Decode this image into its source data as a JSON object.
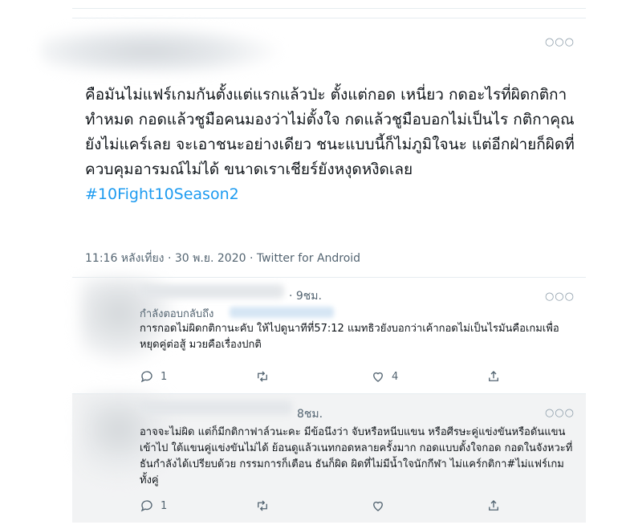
{
  "main_tweet": {
    "more_icon": "more-horizontal-icon",
    "text": "คือมันไม่แฟร์เกมกันตั้งแต่แรกแล้วป่ะ ตั้งแต่กอด เหนี่ยว กดอะไรที่ผิดกติกาทำหมด กอดแล้วชูมือคนมองว่าไม่ตั้งใจ กดแล้วชูมือบอกไม่เป็นไร กติกาคุณยังไม่แคร์เลย จะเอาชนะอย่างเดียว ชนะแบบนี้ก็ไม่ภูมิใจนะ แต่อีกฝ่ายก็ผิดที่ควบคุมอารมณ์ไม่ได้ ขนาดเราเชียร์ยังหงุดหงิดเลย",
    "hashtag": "#10Fight10Season2",
    "meta": "11:16 หลังเที่ยง · 30 พ.ย. 2020 · Twitter for Android"
  },
  "replies": [
    {
      "time": "· 9ชม.",
      "replying_to": "กำลังตอบกลับถึง",
      "text": "การกอดไม่ผิดกติกานะคับ ให้ไปดูนาทีที่57:12 แมทธิวยังบอกว่าเค้ากอดไม่เป็นไรมันคือเกมเพื่อหยุดคู่ต่อสู้ มวยคือเรื่องปกติ",
      "reply_count": "1",
      "retweet_count": "",
      "like_count": "4"
    },
    {
      "time": "8ชม.",
      "text": "อาจจะไม่ผิด แต่ก็มีกติกาฟาล์วนะคะ มีข้อนึงว่า จับหรือหนีบแขน หรือศีรษะคู่แข่งขันหรือดันแขนเข้าไป ใต้แขนคู่แข่งขันไม่ได้ ย้อนดูแล้วเนทกอดหลายครั้งมาก กอดแบบตั้งใจกอด กอดในจังหวะที่ธันกำลังได้เปรียบด้วย กรรมการก็เตือน ธันก็ผิด ผิดที่ไม่มีน้ำใจนักกีฬา ไม่แคร์กติกา#ไม่แฟร์เกมทั้งคู่",
      "reply_count": "1",
      "retweet_count": "",
      "like_count": ""
    }
  ],
  "colors": {
    "hashtag": "#1d9bf0",
    "secondary_text": "#536471",
    "highlight_bg": "#f2f3f4"
  }
}
